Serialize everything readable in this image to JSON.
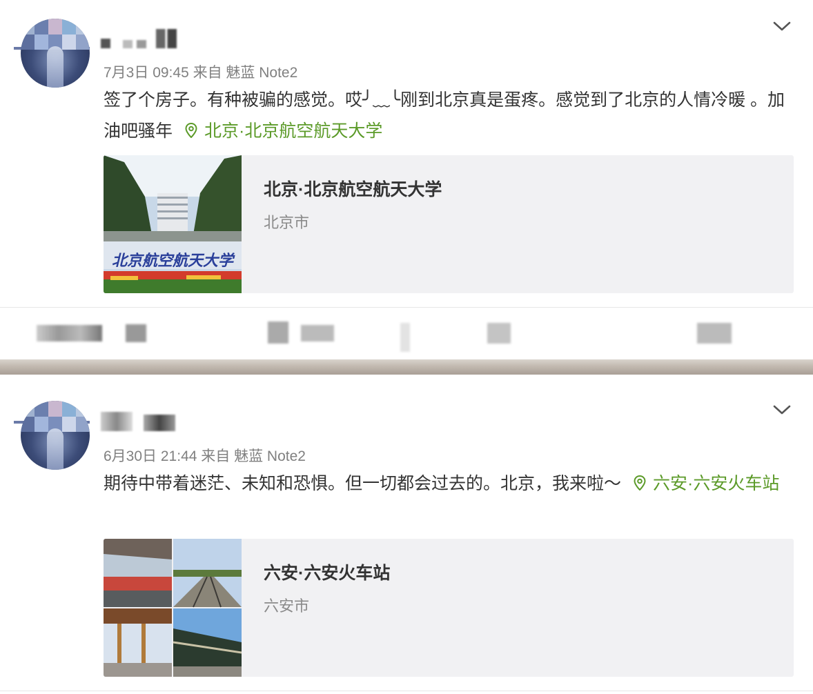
{
  "posts": [
    {
      "meta": "7月3日 09:45 来自 魅蓝 Note2",
      "text": "签了个房子。有种被骗的感觉。哎╯﹏╰刚到北京真是蛋疼。感觉到了北京的人情冷暖 。加油吧骚年",
      "location_link": "北京·北京航空航天大学",
      "card": {
        "title": "北京·北京航空航天大学",
        "subtitle": "北京市",
        "image_text": "北京航空航天大学"
      }
    },
    {
      "meta": "6月30日 21:44 来自 魅蓝 Note2",
      "text": "期待中带着迷茫、未知和恐惧。但一切都会过去的。北京，我来啦～",
      "location_link": "六安·六安火车站",
      "card": {
        "title": "六安·六安火车站",
        "subtitle": "六安市"
      }
    }
  ],
  "icons": {
    "more": "chevron-down-icon",
    "location": "location-pin-icon"
  },
  "colors": {
    "link": "#5b9a28",
    "meta": "#808080",
    "text": "#333333",
    "card_bg": "#f1f1f3"
  }
}
